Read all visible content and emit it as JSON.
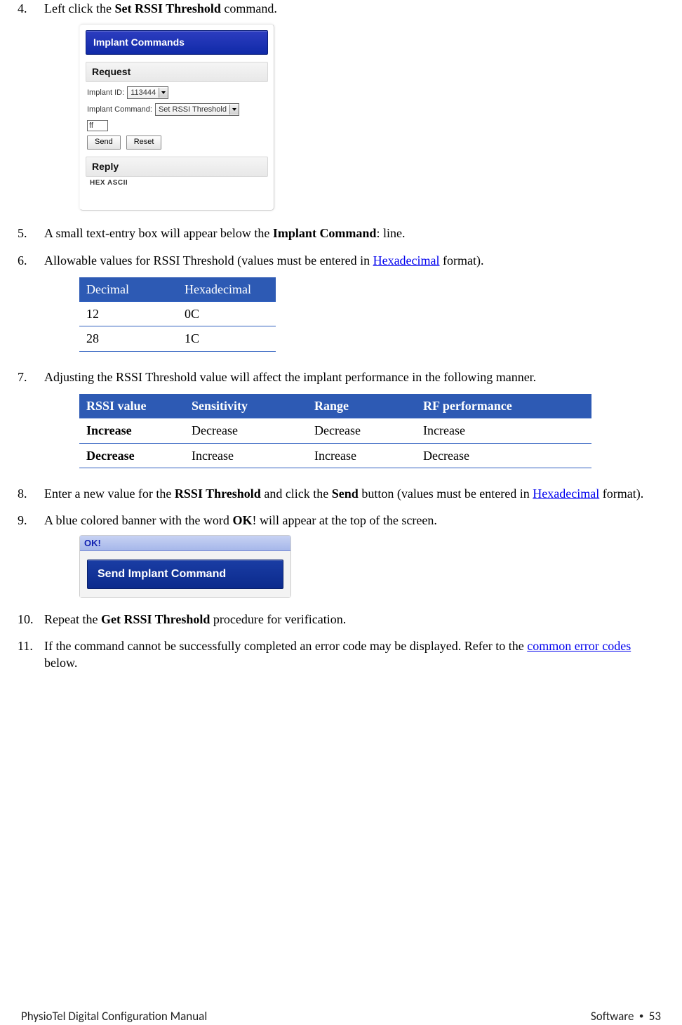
{
  "footer": {
    "left": "PhysioTel Digital Configuration Manual",
    "right_section": "Software",
    "right_bullet": "•",
    "right_page": "53"
  },
  "steps": {
    "s4": {
      "num": "4.",
      "pre": "Left click the ",
      "bold": "Set RSSI Threshold",
      "post": " command."
    },
    "s5": {
      "num": "5.",
      "pre": "A small text-entry box will appear below the ",
      "bold": "Implant Command",
      "post": ": line."
    },
    "s6": {
      "num": "6.",
      "pre": "Allowable values for RSSI Threshold (values must be entered in ",
      "link": "Hexadecimal",
      "post": " format)."
    },
    "s7": {
      "num": "7.",
      "text": "Adjusting the RSSI Threshold value will affect the implant performance in the following manner."
    },
    "s8": {
      "num": "8.",
      "pre": " Enter a new value for the ",
      "bold1": "RSSI Threshold",
      "mid": " and click the ",
      "bold2": "Send",
      "post1": " button (values must be entered in ",
      "link": "Hexadecimal",
      "post2": " format)."
    },
    "s9": {
      "num": "9.",
      "pre": "A blue colored banner with the word ",
      "bold": "OK",
      "post": "! will appear at the top of the screen."
    },
    "s10": {
      "num": "10.",
      "pre": "Repeat the ",
      "bold": "Get RSSI Threshold",
      "post": " procedure for verification."
    },
    "s11": {
      "num": "11.",
      "pre": "If the command cannot be successfully completed an error code may be displayed. Refer to the ",
      "link": "common error codes",
      "post": " below."
    }
  },
  "shot1": {
    "title": "Implant Commands",
    "request": "Request",
    "implant_id_lbl": "Implant ID:",
    "implant_id_val": "113444",
    "implant_cmd_lbl": "Implant Command:",
    "implant_cmd_val": "Set RSSI Threshold",
    "txt_val": "ff",
    "send": "Send",
    "reset": "Reset",
    "reply": "Reply",
    "hex": "HEX ASCII"
  },
  "table1": {
    "h1": "Decimal",
    "h2": "Hexadecimal",
    "r": [
      {
        "a": "12",
        "b": "0C"
      },
      {
        "a": "28",
        "b": "1C"
      }
    ]
  },
  "table2": {
    "h": [
      "RSSI value",
      "Sensitivity",
      "Range",
      "RF performance"
    ],
    "r": [
      {
        "a": "Increase",
        "b": "Decrease",
        "c": "Decrease",
        "d": "Increase"
      },
      {
        "a": "Decrease",
        "b": "Increase",
        "c": "Increase",
        "d": "Decrease"
      }
    ]
  },
  "shot2": {
    "ok": "OK!",
    "title": "Send Implant Command"
  }
}
